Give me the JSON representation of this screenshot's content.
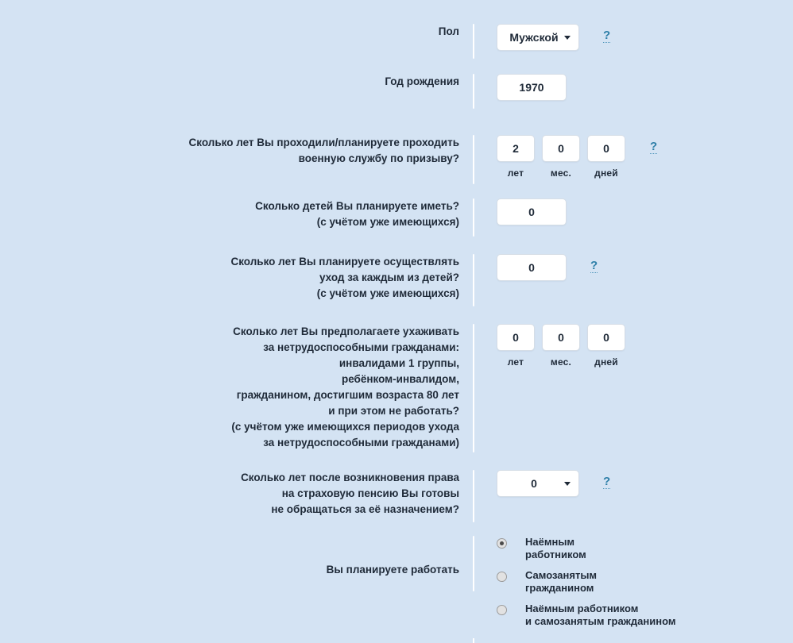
{
  "page": {
    "background_color": "#d4e3f3",
    "text_color": "#1f2a38",
    "help_link_color": "#2e7fa8",
    "help_symbol": "?"
  },
  "units": {
    "years": "лет",
    "months": "мес.",
    "days": "дней"
  },
  "rows": {
    "gender": {
      "label": "Пол",
      "value": "Мужской"
    },
    "birth_year": {
      "label": "Год рождения",
      "value": "1970"
    },
    "military_service": {
      "label_line1": "Сколько лет Вы проходили/планируете проходить",
      "label_line2": "военную службу по призыву?",
      "years": "2",
      "months": "0",
      "days": "0"
    },
    "children_count": {
      "label_line1": "Сколько детей Вы планируете иметь?",
      "label_line2": "(с учётом уже имеющихся)",
      "value": "0"
    },
    "childcare_years": {
      "label_line1": "Сколько лет Вы планируете осуществлять",
      "label_line2": "уход за каждым из детей?",
      "label_line3": "(с учётом уже имеющихся)",
      "value": "0"
    },
    "disabled_care": {
      "label_line1": "Сколько лет Вы предполагаете ухаживать",
      "label_line2": "за нетрудоспособными гражданами:",
      "label_line3": "инвалидами 1 группы,",
      "label_line4": "ребёнком-инвалидом,",
      "label_line5": "гражданином, достигшим возраста 80 лет",
      "label_line6": "и при этом не работать?",
      "label_line7": "(с учётом уже имеющихся периодов ухода",
      "label_line8": "за нетрудоспособными гражданами)",
      "years": "0",
      "months": "0",
      "days": "0"
    },
    "deferral_years": {
      "label_line1": "Сколько лет после возникновения права",
      "label_line2": "на страховую пенсию Вы готовы",
      "label_line3": "не обращаться за её назначением?",
      "value": "0"
    },
    "employment": {
      "label": "Вы планируете работать",
      "options": [
        {
          "line1": "Наёмным",
          "line2": "работником",
          "selected": true
        },
        {
          "line1": "Самозанятым",
          "line2": "гражданином",
          "selected": false
        },
        {
          "line1": "Наёмным работником",
          "line2": "и самозанятым гражданином",
          "selected": false
        }
      ]
    }
  }
}
